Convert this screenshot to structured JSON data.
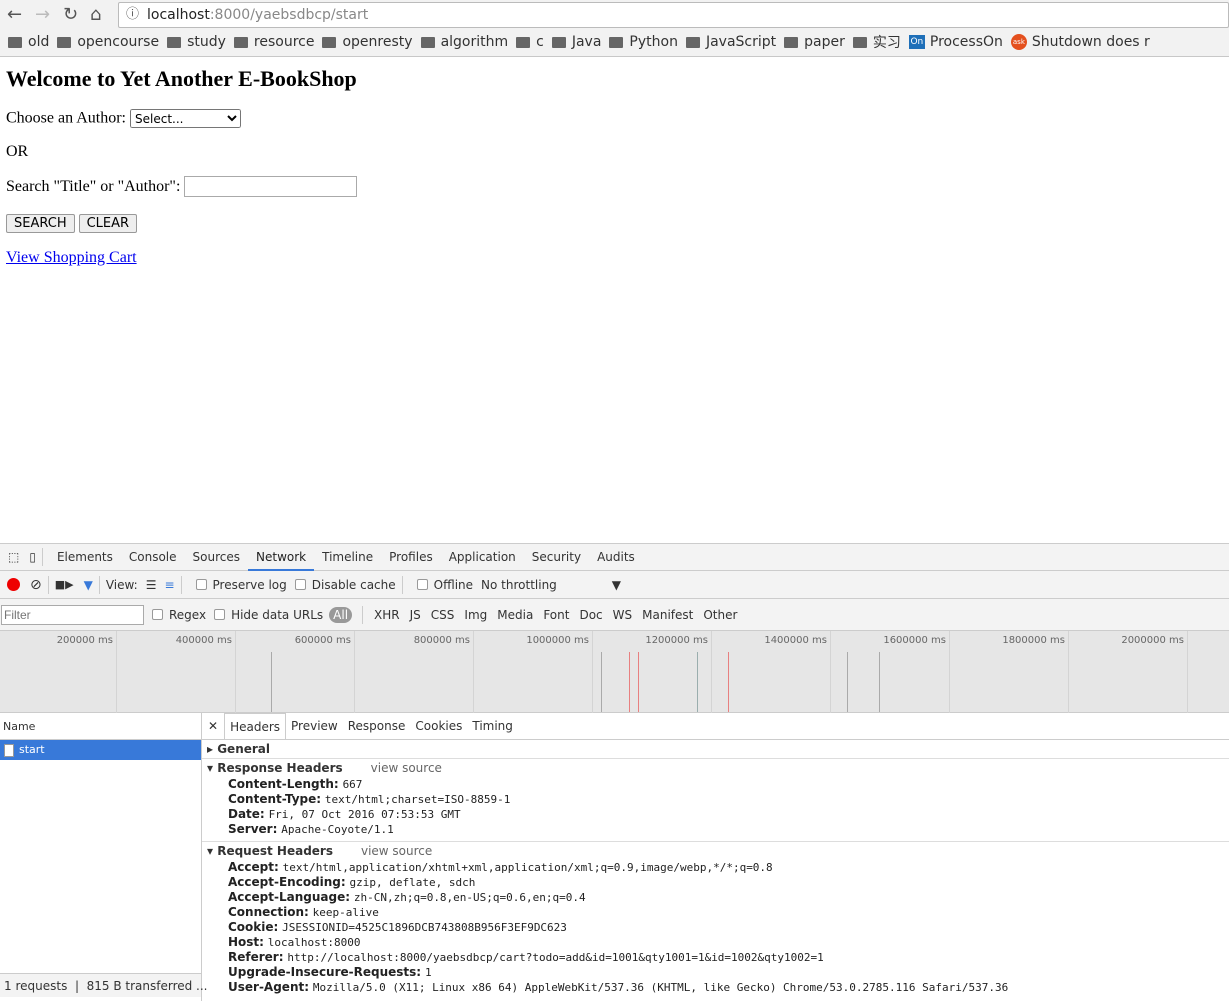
{
  "browser": {
    "url_host": "localhost",
    "url_rest": ":8000/yaebsdbcp/start",
    "bookmarks": [
      {
        "label": "old",
        "icon": "folder"
      },
      {
        "label": "opencourse",
        "icon": "folder"
      },
      {
        "label": "study",
        "icon": "folder"
      },
      {
        "label": "resource",
        "icon": "folder"
      },
      {
        "label": "openresty",
        "icon": "folder"
      },
      {
        "label": "algorithm",
        "icon": "folder"
      },
      {
        "label": "c",
        "icon": "folder"
      },
      {
        "label": "Java",
        "icon": "folder"
      },
      {
        "label": "Python",
        "icon": "folder"
      },
      {
        "label": "JavaScript",
        "icon": "folder"
      },
      {
        "label": "paper",
        "icon": "folder"
      },
      {
        "label": "实习",
        "icon": "folder"
      },
      {
        "label": "ProcessOn",
        "icon": "processon",
        "badge": "On"
      },
      {
        "label": "Shutdown does r",
        "icon": "ask",
        "badge": "ask"
      }
    ]
  },
  "page": {
    "title": "Welcome to Yet Another E-BookShop",
    "author_label": "Choose an Author:",
    "author_select": "Select...",
    "or": "OR",
    "search_label": "Search \"Title\" or \"Author\":",
    "search_value": "",
    "search_btn": "SEARCH",
    "clear_btn": "CLEAR",
    "cart_link": "View Shopping Cart"
  },
  "devtools": {
    "tabs": [
      "Elements",
      "Console",
      "Sources",
      "Network",
      "Timeline",
      "Profiles",
      "Application",
      "Security",
      "Audits"
    ],
    "active_tab": "Network",
    "toolbar": {
      "view": "View:",
      "preserve": "Preserve log",
      "disable_cache": "Disable cache",
      "offline": "Offline",
      "throttle": "No throttling"
    },
    "filter": {
      "placeholder": "Filter",
      "regex": "Regex",
      "hide_data": "Hide data URLs",
      "types": [
        "All",
        "XHR",
        "JS",
        "CSS",
        "Img",
        "Media",
        "Font",
        "Doc",
        "WS",
        "Manifest",
        "Other"
      ]
    },
    "timeline": {
      "ticks": [
        "200000 ms",
        "400000 ms",
        "600000 ms",
        "800000 ms",
        "1000000 ms",
        "1200000 ms",
        "1400000 ms",
        "1600000 ms",
        "1800000 ms",
        "2000000 ms"
      ],
      "events": [
        {
          "t": 459000,
          "color": "#aaaaaa"
        },
        {
          "t": 1013000,
          "color": "#aaaaaa"
        },
        {
          "t": 1060000,
          "color": "#e88080"
        },
        {
          "t": 1076000,
          "color": "#e88080"
        },
        {
          "t": 1175000,
          "color": "#9aaeae"
        },
        {
          "t": 1227000,
          "color": "#e88080"
        },
        {
          "t": 1427000,
          "color": "#aaaaaa"
        },
        {
          "t": 1481000,
          "color": "#aaaaaa"
        }
      ]
    },
    "name_header": "Name",
    "requests": [
      "start"
    ],
    "status": "1 requests  |  815 B transferred ...",
    "detail_tabs": [
      "Headers",
      "Preview",
      "Response",
      "Cookies",
      "Timing"
    ],
    "general": "General",
    "response_headers": "Response Headers",
    "request_headers": "Request Headers",
    "view_source": "view source",
    "response": [
      [
        "Content-Length:",
        "667"
      ],
      [
        "Content-Type:",
        "text/html;charset=ISO-8859-1"
      ],
      [
        "Date:",
        "Fri, 07 Oct 2016 07:53:53 GMT"
      ],
      [
        "Server:",
        "Apache-Coyote/1.1"
      ]
    ],
    "request": [
      [
        "Accept:",
        "text/html,application/xhtml+xml,application/xml;q=0.9,image/webp,*/*;q=0.8"
      ],
      [
        "Accept-Encoding:",
        "gzip, deflate, sdch"
      ],
      [
        "Accept-Language:",
        "zh-CN,zh;q=0.8,en-US;q=0.6,en;q=0.4"
      ],
      [
        "Connection:",
        "keep-alive"
      ],
      [
        "Cookie:",
        "JSESSIONID=4525C1896DCB743808B956F3EF9DC623"
      ],
      [
        "Host:",
        "localhost:8000"
      ],
      [
        "Referer:",
        "http://localhost:8000/yaebsdbcp/cart?todo=add&id=1001&qty1001=1&id=1002&qty1002=1"
      ],
      [
        "Upgrade-Insecure-Requests:",
        "1"
      ],
      [
        "User-Agent:",
        "Mozilla/5.0 (X11; Linux x86 64) AppleWebKit/537.36 (KHTML, like Gecko) Chrome/53.0.2785.116 Safari/537.36"
      ]
    ]
  }
}
